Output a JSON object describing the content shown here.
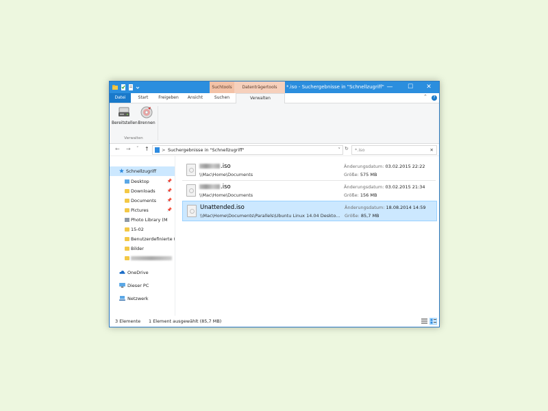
{
  "title_bar": {
    "title": "*.iso - Suchergebnisse in \"Schnellzugriff\"",
    "context_labels": [
      "Suchtools",
      "Datenträgertools"
    ],
    "minimize_glyph": "—",
    "maximize_glyph": "☐",
    "close_glyph": "✕",
    "quick_access_icons": [
      "app-icon",
      "properties-icon",
      "new-folder-icon",
      "customize-quick-access-icon"
    ],
    "accent_color": "#2b8ede"
  },
  "ribbon_tabs": {
    "file": "Datei",
    "start": "Start",
    "share": "Freigeben",
    "view": "Ansicht",
    "search": "Suchen",
    "manage": "Verwalten",
    "expand_glyph": "⌃",
    "help_glyph": "?"
  },
  "ribbon": {
    "buttons": [
      {
        "label": "Bereitstellen",
        "icon": "mount-drive-icon"
      },
      {
        "label": "Brennen",
        "icon": "burn-disc-icon"
      }
    ],
    "group_label": "Verwalten"
  },
  "address_bar": {
    "back_glyph": "←",
    "forward_glyph": "→",
    "history_glyph": "˅",
    "up_glyph": "↑",
    "path": "Suchergebnisse in \"Schnellzugriff\"",
    "separator": ">",
    "dropdown_glyph": "˅",
    "refresh_glyph": "↻",
    "search_placeholder": "*.iso",
    "clear_glyph": "✕"
  },
  "nav": {
    "quick_access": "Schnellzugriff",
    "items": [
      {
        "label": "Desktop",
        "pinned": true
      },
      {
        "label": "Downloads",
        "pinned": true
      },
      {
        "label": "Documents",
        "pinned": true
      },
      {
        "label": "Pictures",
        "pinned": true
      },
      {
        "label": "Photo Library (M",
        "pinned": false
      },
      {
        "label": "15-02",
        "pinned": false
      },
      {
        "label": "Benutzerdefinierte (",
        "pinned": false
      },
      {
        "label": "Bilder",
        "pinned": false
      }
    ],
    "pin_glyph": "📌",
    "onedrive": "OneDrive",
    "this_pc": "Dieser PC",
    "network": "Netzwerk"
  },
  "files": [
    {
      "name_suffix": ".iso",
      "path": "\\\\Mac\\Home\\Documents",
      "date_label": "Änderungsdatum:",
      "date": "03.02.2015 22:22",
      "size_label": "Größe:",
      "size": "575 MB",
      "selected": false
    },
    {
      "name_suffix": ".iso",
      "path": "\\\\Mac\\Home\\Documents",
      "date_label": "Änderungsdatum:",
      "date": "03.02.2015 21:34",
      "size_label": "Größe:",
      "size": "156 MB",
      "selected": false
    },
    {
      "name": "Unattended.iso",
      "path": "\\\\Mac\\Home\\Documents\\Parallels\\Ubuntu Linux 14.04 Deskto...",
      "date_label": "Änderungsdatum:",
      "date": "18.08.2014 14:59",
      "size_label": "Größe:",
      "size": "85,7 MB",
      "selected": true
    }
  ],
  "status": {
    "count": "3 Elemente",
    "selection": "1 Element ausgewählt (85,7 MB)"
  },
  "colors": {
    "selection": "#cce8ff",
    "context_tab": "#f3c2a7",
    "file_tab": "#1979ca"
  }
}
